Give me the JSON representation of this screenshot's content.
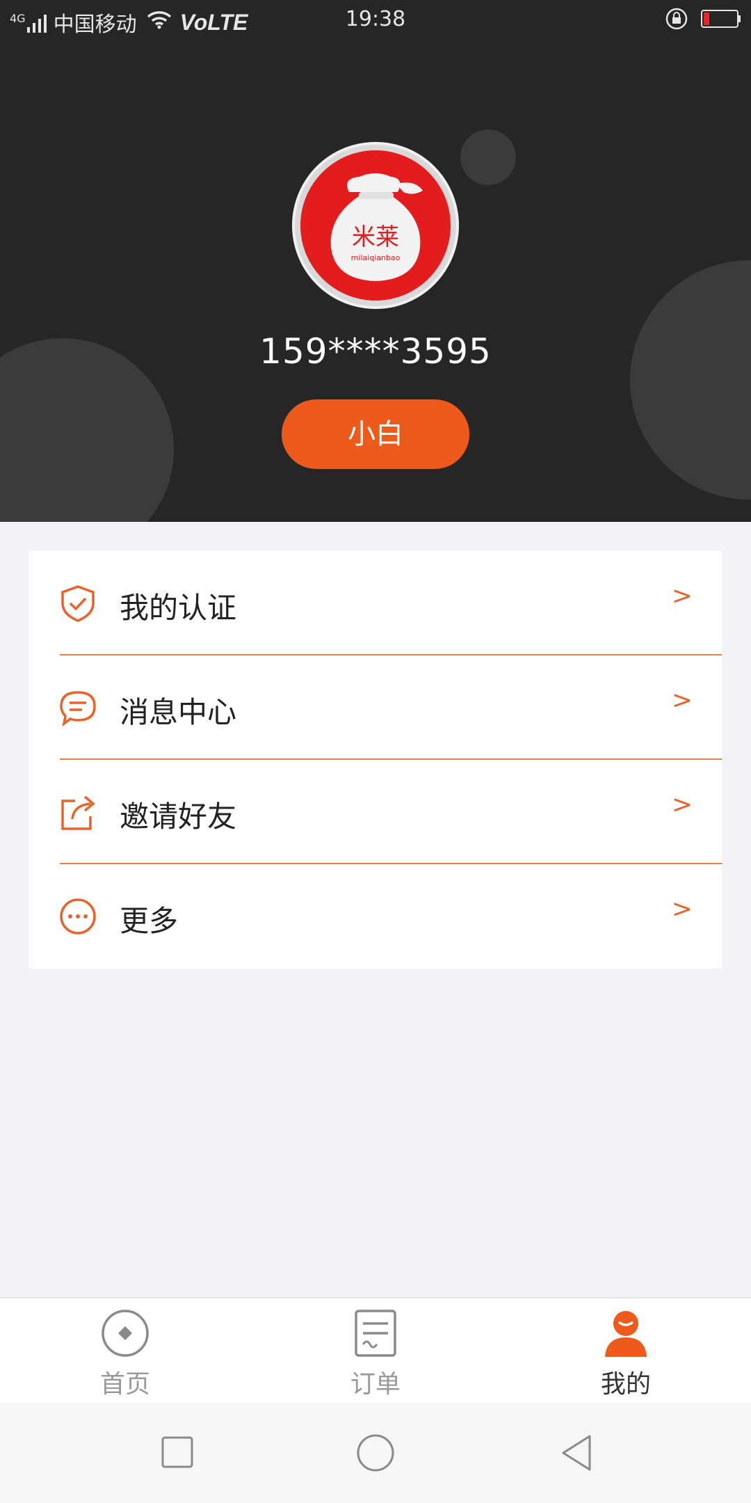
{
  "status_bar": {
    "network": "4G",
    "carrier": "中国移动",
    "volte": "VoLTE",
    "time": "19:38"
  },
  "profile": {
    "logo_text": "米莱",
    "logo_subtext": "milaiqianbao",
    "phone": "159****3595",
    "level_label": "小白"
  },
  "menu": {
    "items": [
      {
        "label": "我的认证",
        "icon": "shield-check-icon",
        "arrow": ">"
      },
      {
        "label": "消息中心",
        "icon": "chat-bubble-icon",
        "arrow": ">"
      },
      {
        "label": "邀请好友",
        "icon": "share-icon",
        "arrow": ">"
      },
      {
        "label": "更多",
        "icon": "more-dots-icon",
        "arrow": ">"
      }
    ]
  },
  "tabbar": {
    "tabs": [
      {
        "label": "首页",
        "icon": "home-diamond-icon",
        "active": false
      },
      {
        "label": "订单",
        "icon": "order-list-icon",
        "active": false
      },
      {
        "label": "我的",
        "icon": "user-icon",
        "active": true
      }
    ]
  },
  "colors": {
    "accent": "#ec5a1c",
    "header_bg": "#262626",
    "page_bg": "#f2f2f7"
  }
}
